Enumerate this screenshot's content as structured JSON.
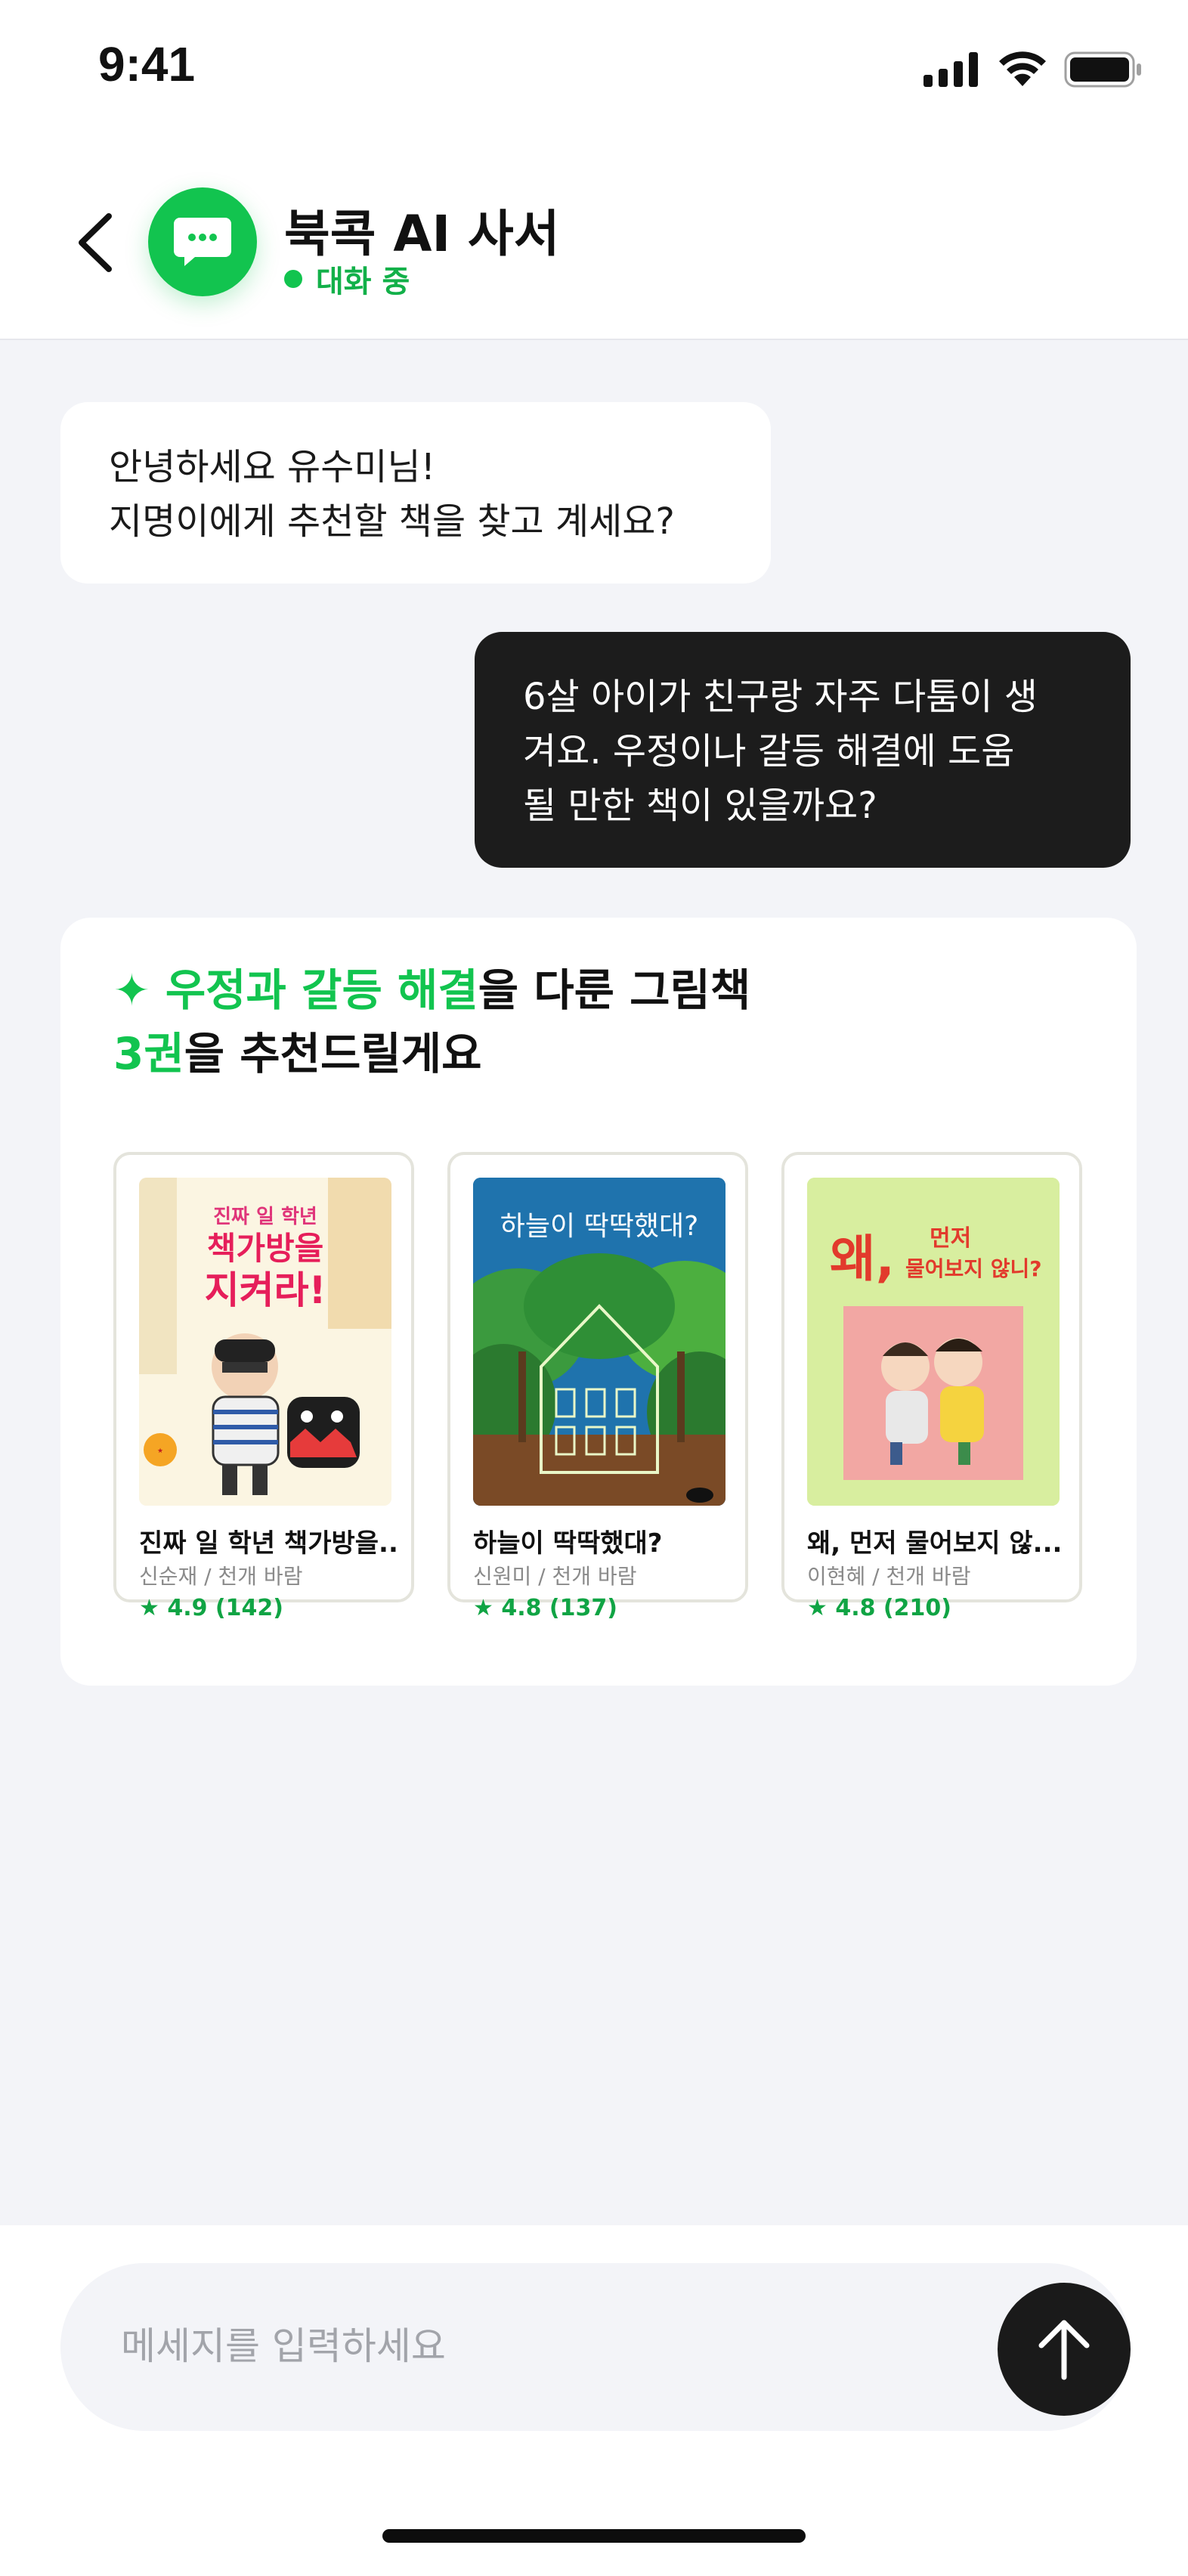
{
  "status_bar": {
    "time": "9:41"
  },
  "header": {
    "back_icon": "chevron-left-icon",
    "avatar_icon": "chat-bubble-icon",
    "title": "북콕 AI 사서",
    "status": "대화 중",
    "accent_color": "#12c44f"
  },
  "messages": {
    "ai_greeting_line1": "안녕하세요 유수미님!",
    "ai_greeting_line2": "지명이에게 추천할 책을 찾고 계세요?",
    "user_line1": "6살 아이가 친구랑 자주 다툼이 생",
    "user_line2": "겨요. 우정이나 갈등 해결에 도움",
    "user_line3": "될 만한 책이 있을까요?"
  },
  "recommendation": {
    "sparkle": "✦",
    "title_highlight": "우정과 갈등 해결",
    "title_rest": "을 다룬 그림책",
    "count_highlight": "3권",
    "count_rest": "을 추천드릴게요",
    "books": [
      {
        "title": "진짜 일 학년 책가방을...",
        "meta": "신순재 / 천개 바람",
        "rating": "★ 4.9 (142)",
        "cover_text_1": "진짜 일 학년",
        "cover_text_2": "책가방을",
        "cover_text_3": "지켜라!"
      },
      {
        "title": "하늘이 딱딱했대?",
        "meta": "신원미 / 천개 바람",
        "rating": "★ 4.8 (137)",
        "cover_text_1": "하늘이 딱딱했대?"
      },
      {
        "title": "왜, 먼저 물어보지 않...",
        "meta": "이현혜 / 천개 바람",
        "rating": "★ 4.8 (210)",
        "cover_text_1": "왜,",
        "cover_text_2": "먼저",
        "cover_text_3": "물어보지 않니?"
      }
    ]
  },
  "input": {
    "placeholder": "메세지를 입력하세요",
    "send_icon": "arrow-up-icon"
  }
}
